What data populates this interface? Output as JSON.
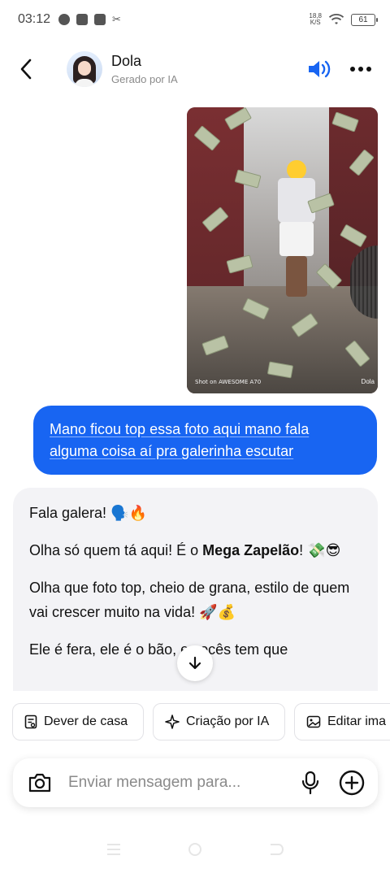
{
  "status_bar": {
    "time": "03:12",
    "net_speed_value": "18,8",
    "net_speed_unit": "K/S",
    "battery": "61",
    "icons": [
      "whatsapp-icon",
      "facebook-icon",
      "outlook-icon",
      "capcut-icon",
      "wifi-icon",
      "battery-icon"
    ]
  },
  "header": {
    "name": "Dola",
    "subtitle": "Gerado por IA",
    "icons": [
      "back-arrow-icon",
      "speaker-icon",
      "more-icon"
    ]
  },
  "chat": {
    "photo": {
      "watermark": "Shot on AWESOME A70",
      "brand": "Dola"
    },
    "user_message": "Mano ficou top essa foto aqui mano fala alguma coisa aí pra galerinha escutar",
    "ai_message": {
      "p1": "Fala galera! 🗣️🔥",
      "p2_before": "Olha só quem tá aqui! É o ",
      "p2_bold": "Mega Zapelão",
      "p2_after": "! 💸😎",
      "p3": "Olha que foto top, cheio de grana, estilo de quem vai crescer muito na vida! 🚀💰",
      "p4": "Ele é fera, ele é o bão, e vocês tem que"
    }
  },
  "chips": [
    {
      "label": "Dever de casa",
      "icon": "homework-icon"
    },
    {
      "label": "Criação por IA",
      "icon": "sparkle-icon"
    },
    {
      "label": "Editar ima",
      "icon": "image-edit-icon"
    }
  ],
  "composer": {
    "placeholder": "Enviar mensagem para..."
  },
  "colors": {
    "accent": "#1865f2",
    "bubble_ai": "#f3f3f6"
  }
}
